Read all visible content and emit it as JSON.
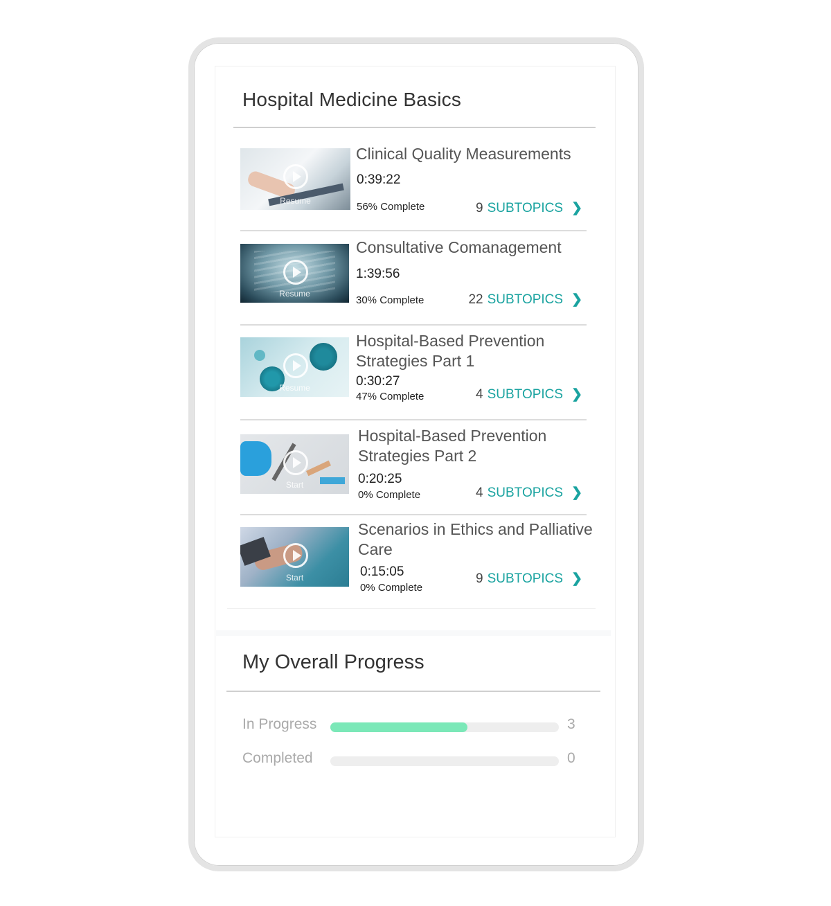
{
  "section_title": "Hospital Medicine Basics",
  "accent_color": "#1aa3a0",
  "courses": [
    {
      "title": "Clinical Quality Measurements",
      "duration": "0:39:22",
      "percent_label": "56% Complete",
      "subtopic_count": "9",
      "subtopics_label": "SUBTOPICS",
      "thumb_action": "Resume",
      "thumb_icon": "doctor-clipboard-image"
    },
    {
      "title": "Consultative Comanagement",
      "duration": "1:39:56",
      "percent_label": "30% Complete",
      "subtopic_count": "22",
      "subtopics_label": "SUBTOPICS",
      "thumb_action": "Resume",
      "thumb_icon": "chest-xray-image"
    },
    {
      "title": "Hospital-Based Prevention Strategies Part 1",
      "duration": "0:30:27",
      "percent_label": "47% Complete",
      "subtopic_count": "4",
      "subtopics_label": "SUBTOPICS",
      "thumb_action": "Resume",
      "thumb_icon": "virus-image"
    },
    {
      "title": "Hospital-Based Prevention Strategies Part 2",
      "duration": "0:20:25",
      "percent_label": "0% Complete",
      "subtopic_count": "4",
      "subtopics_label": "SUBTOPICS",
      "thumb_action": "Start",
      "thumb_icon": "medical-supplies-image"
    },
    {
      "title": "Scenarios in Ethics and Palliative Care",
      "duration": "0:15:05",
      "percent_label": "0% Complete",
      "subtopic_count": "9",
      "subtopics_label": "SUBTOPICS",
      "thumb_action": "Start",
      "thumb_icon": "holding-hands-image"
    }
  ],
  "progress": {
    "title": "My Overall Progress",
    "rows": [
      {
        "label": "In Progress",
        "value": "3",
        "fill_fraction": 0.6,
        "fill_color": "#7be8b8"
      },
      {
        "label": "Completed",
        "value": "0",
        "fill_fraction": 0,
        "fill_color": "#7be8b8"
      }
    ]
  }
}
